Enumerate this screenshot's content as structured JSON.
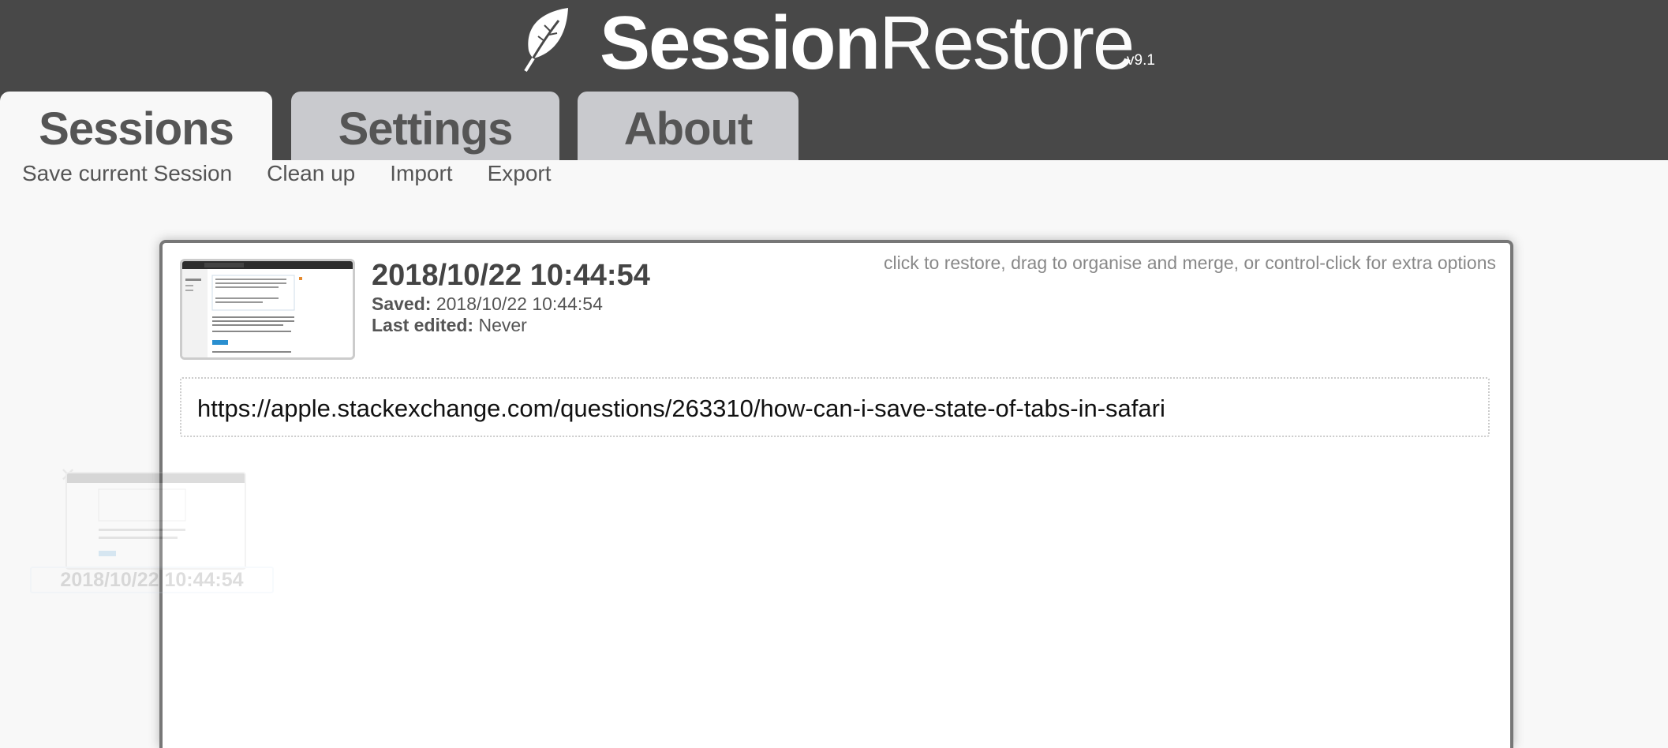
{
  "app": {
    "brand_bold": "Session",
    "brand_light": "Restore",
    "version": "v9.1",
    "logo_icon": "leaf-icon"
  },
  "tabs": [
    {
      "label": "Sessions",
      "active": true
    },
    {
      "label": "Settings",
      "active": false
    },
    {
      "label": "About",
      "active": false
    }
  ],
  "actions": [
    {
      "label": "Save current Session"
    },
    {
      "label": "Clean up"
    },
    {
      "label": "Import"
    },
    {
      "label": "Export"
    }
  ],
  "session": {
    "title": "2018/10/22 10:44:54",
    "saved_label": "Saved:",
    "saved_value": "2018/10/22 10:44:54",
    "edited_label": "Last edited:",
    "edited_value": "Never",
    "hint": "click to restore, drag to organise and merge, or control-click for extra options",
    "tabs": [
      {
        "url": "https://apple.stackexchange.com/questions/263310/how-can-i-save-state-of-tabs-in-safari"
      }
    ]
  },
  "drag_ghost": {
    "label": "2018/10/22 10:44:54"
  },
  "colors": {
    "header_bg": "#484848",
    "tab_inactive": "#c9cace",
    "page_bg": "#f8f8f8",
    "card_border": "#777777"
  }
}
